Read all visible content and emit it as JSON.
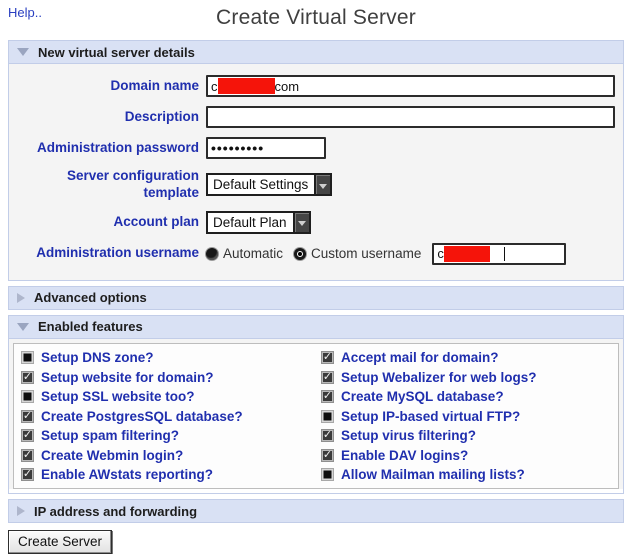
{
  "page": {
    "help_link": "Help..",
    "title": "Create Virtual Server"
  },
  "sections": {
    "details": {
      "title": "New virtual server details",
      "state": "expanded"
    },
    "advanced": {
      "title": "Advanced options",
      "state": "collapsed"
    },
    "features": {
      "title": "Enabled features",
      "state": "expanded"
    },
    "ip": {
      "title": "IP address and forwarding",
      "state": "collapsed"
    }
  },
  "form": {
    "domain": {
      "label": "Domain name",
      "value_prefix": "c",
      "value_suffix": "com",
      "redacted": true
    },
    "description": {
      "label": "Description",
      "value": ""
    },
    "password": {
      "label": "Administration password",
      "value": "•••••••••"
    },
    "template": {
      "label": "Server configuration template",
      "selected": "Default Settings"
    },
    "plan": {
      "label": "Account plan",
      "selected": "Default Plan"
    },
    "username": {
      "label": "Administration username",
      "options": [
        {
          "label": "Automatic",
          "state": "solid"
        },
        {
          "label": "Custom username",
          "state": "selected"
        }
      ],
      "custom_value_prefix": "c",
      "redacted": true
    }
  },
  "features": {
    "left": [
      {
        "label": "Setup DNS zone?",
        "state": "solid"
      },
      {
        "label": "Setup website for domain?",
        "state": "checked"
      },
      {
        "label": "Setup SSL website too?",
        "state": "solid"
      },
      {
        "label": "Create PostgresSQL database?",
        "state": "checked"
      },
      {
        "label": "Setup spam filtering?",
        "state": "checked"
      },
      {
        "label": "Create Webmin login?",
        "state": "checked"
      },
      {
        "label": "Enable AWstats reporting?",
        "state": "checked"
      }
    ],
    "right": [
      {
        "label": "Accept mail for domain?",
        "state": "checked"
      },
      {
        "label": "Setup Webalizer for web logs?",
        "state": "checked"
      },
      {
        "label": "Create MySQL database?",
        "state": "checked"
      },
      {
        "label": "Setup IP-based virtual FTP?",
        "state": "solid"
      },
      {
        "label": "Setup virus filtering?",
        "state": "checked"
      },
      {
        "label": "Enable DAV logins?",
        "state": "checked"
      },
      {
        "label": "Allow Mailman mailing lists?",
        "state": "solid"
      }
    ]
  },
  "footer": {
    "create_button": "Create Server"
  },
  "colors": {
    "section_header_bg": "#d9e1f4",
    "label_blue": "#202fae",
    "redaction_red": "#f5140a"
  }
}
